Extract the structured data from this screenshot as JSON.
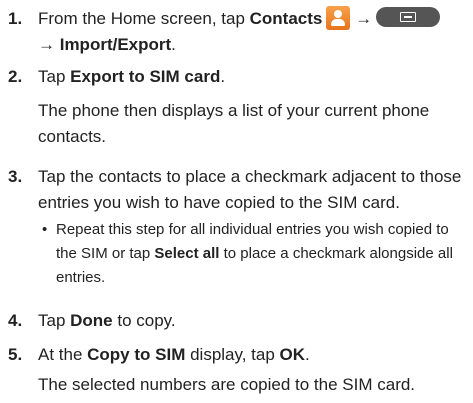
{
  "steps": [
    {
      "number": "1.",
      "text_a": "From the Home screen, tap ",
      "contacts": "Contacts",
      "arrow": " →",
      "line2": "→ Import/Export",
      "line2_end": ".",
      "icons": [
        "contacts-app-icon",
        "menu-key-icon"
      ]
    },
    {
      "number": "2.",
      "text_a": "Tap ",
      "bold": "Export to SIM card",
      "text_b": ".",
      "note": "The phone then displays a list of your current phone contacts."
    },
    {
      "number": "3.",
      "text": "Tap the contacts to place a checkmark adjacent to those entries you wish to have copied to the SIM card.",
      "sub_bullet": "•",
      "sub_a": "Repeat this step for all individual entries you wish copied to the SIM or tap ",
      "sub_bold": "Select all",
      "sub_b": " to place a checkmark alongside all entries."
    },
    {
      "number": "4.",
      "text_a": "Tap ",
      "bold": "Done",
      "text_b": " to copy."
    },
    {
      "number": "5.",
      "text_a": "At the ",
      "bold_a": "Copy to SIM",
      "text_b": " display, tap ",
      "bold_b": "OK",
      "text_c": ".",
      "note": "The selected numbers are copied to the SIM card."
    }
  ],
  "colors": {
    "contacts_icon": "#f08a2c",
    "menu_key": "#555555"
  }
}
